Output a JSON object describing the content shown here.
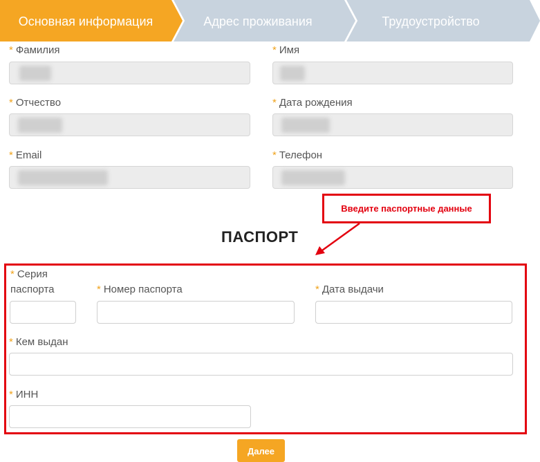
{
  "steps": [
    {
      "label": "Основная информация",
      "state": "active"
    },
    {
      "label": "Адрес проживания",
      "state": "inactive"
    },
    {
      "label": "Трудоустройство",
      "state": "inactive"
    }
  ],
  "colors": {
    "active_step": "#f5a623",
    "inactive_step": "#c8d3de",
    "required_star": "#f0a31d",
    "annotation": "#e3000f",
    "button": "#f5a623"
  },
  "required_mark": "*",
  "personal": {
    "last_name_label": "Фамилия",
    "first_name_label": "Имя",
    "middle_name_label": "Отчество",
    "birth_date_label": "Дата рождения",
    "email_label": "Email",
    "phone_label": "Телефон"
  },
  "annotation": {
    "text": "Введите паспортные данные"
  },
  "passport": {
    "title": "ПАСПОРТ",
    "series_label_line1": "Серия",
    "series_label_line2": "паспорта",
    "number_label": "Номер паспорта",
    "issue_date_label": "Дата выдачи",
    "issued_by_label": "Кем выдан",
    "inn_label": "ИНН"
  },
  "next_button": "Далее"
}
